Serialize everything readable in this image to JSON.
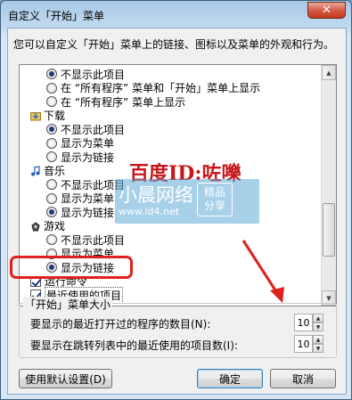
{
  "window": {
    "title": "自定义「开始」菜单",
    "close_symbol": "✕"
  },
  "description": "您可以自定义「开始」菜单上的链接、图标以及菜单的外观和行为。",
  "list": {
    "rows": [
      {
        "kind": "radio",
        "indent": 2,
        "checked": true,
        "label": "不显示此项目"
      },
      {
        "kind": "radio",
        "indent": 2,
        "checked": false,
        "label": "在 “所有程序” 菜单和「开始」菜单上显示"
      },
      {
        "kind": "radio",
        "indent": 2,
        "checked": false,
        "label": "在 “所有程序” 菜单上显示"
      },
      {
        "kind": "category",
        "indent": 1,
        "icon": "download-folder-icon",
        "label": "下载"
      },
      {
        "kind": "radio",
        "indent": 2,
        "checked": true,
        "label": "不显示此项目"
      },
      {
        "kind": "radio",
        "indent": 2,
        "checked": false,
        "label": "显示为菜单"
      },
      {
        "kind": "radio",
        "indent": 2,
        "checked": false,
        "label": "显示为链接"
      },
      {
        "kind": "category",
        "indent": 1,
        "icon": "music-icon",
        "label": "音乐"
      },
      {
        "kind": "radio",
        "indent": 2,
        "checked": false,
        "label": "不显示此项目"
      },
      {
        "kind": "radio",
        "indent": 2,
        "checked": false,
        "label": "显示为菜单"
      },
      {
        "kind": "radio",
        "indent": 2,
        "checked": true,
        "label": "显示为链接"
      },
      {
        "kind": "category",
        "indent": 1,
        "icon": "games-icon",
        "label": "游戏"
      },
      {
        "kind": "radio",
        "indent": 2,
        "checked": false,
        "label": "不显示此项目"
      },
      {
        "kind": "radio",
        "indent": 2,
        "checked": false,
        "label": "显示为菜单"
      },
      {
        "kind": "radio",
        "indent": 2,
        "checked": true,
        "label": "显示为链接"
      },
      {
        "kind": "checkbox",
        "indent": 1,
        "checked": true,
        "label": "运行命令"
      },
      {
        "kind": "checkbox",
        "indent": 1,
        "checked": true,
        "label": "最近使用的项目",
        "selected": true
      }
    ]
  },
  "size_group": {
    "title": "「开始」菜单大小",
    "recent_programs_label": "要显示的最近打开过的程序的数目(N):",
    "recent_programs_value": "10",
    "jump_list_label": "要显示在跳转列表中的最近使用的项目数(I):",
    "jump_list_value": "10"
  },
  "buttons": {
    "defaults": "使用默认设置(D)",
    "ok": "确定",
    "cancel": "取消"
  },
  "watermark": {
    "baidu": "百度ID:咗嚛",
    "site_name": "小晨网络",
    "site_url": "www.ld4.net",
    "badge_line1": "精品",
    "badge_line2": "分享"
  },
  "colors": {
    "highlight": "#e0201c",
    "watermark_red": "#c8171b"
  }
}
